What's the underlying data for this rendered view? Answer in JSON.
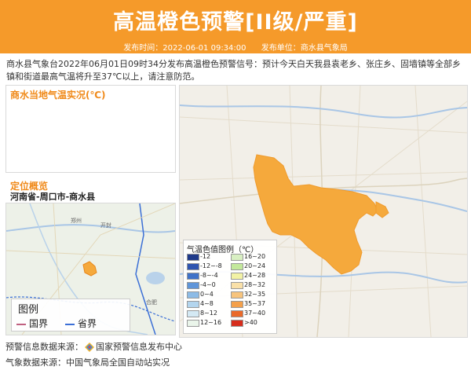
{
  "header": {
    "title": "高温橙色预警[II级/严重]",
    "publish_time_label": "发布时间：2022-06-01 09:34:00",
    "publish_unit_label": "发布单位：商水县气象局"
  },
  "notice_text": "商水县气象台2022年06月01日09时34分发布高温橙色预警信号：预计今天白天我县袁老乡、张庄乡、固墙镇等全部乡镇和街道最高气温将升至37℃以上，请注意防范。",
  "left_panel": {
    "title": "商水当地气温实况(℃)"
  },
  "location": {
    "title": "定位概览",
    "path": "河南省-周口市-商水县"
  },
  "minimap": {
    "legend_title": "图例",
    "items": [
      {
        "label": "国界",
        "color": "#c06080"
      },
      {
        "label": "省界",
        "color": "#3b6fd6"
      }
    ],
    "place_labels": [
      "郑州",
      "开封",
      "合肥"
    ]
  },
  "legend": {
    "title": "气温色值图例（℃）",
    "left": [
      {
        "label": "-12",
        "color": "#1f3a8a"
      },
      {
        "label": "-12~-8",
        "color": "#2f55b0"
      },
      {
        "label": "-8~-4",
        "color": "#3f72c8"
      },
      {
        "label": "-4~0",
        "color": "#5f95d9"
      },
      {
        "label": "0~4",
        "color": "#8dbbe6"
      },
      {
        "label": "4~8",
        "color": "#b3d5ee"
      },
      {
        "label": "8~12",
        "color": "#d4e9f4"
      },
      {
        "label": "12~16",
        "color": "#eaf5ea"
      }
    ],
    "right": [
      {
        "label": "16~20",
        "color": "#d8efc2"
      },
      {
        "label": "20~24",
        "color": "#c3e89b"
      },
      {
        "label": "24~28",
        "color": "#f2f2a5"
      },
      {
        "label": "28~32",
        "color": "#f9e0a8"
      },
      {
        "label": "32~35",
        "color": "#f7c47d"
      },
      {
        "label": "35~37",
        "color": "#f4a04a"
      },
      {
        "label": "37~40",
        "color": "#ea6a2a"
      },
      {
        "label": ">40",
        "color": "#d62d1c"
      }
    ]
  },
  "footer": {
    "warning_source": "预警信息数据来源：",
    "warning_source_name": "国家预警信息发布中心",
    "weather_source": "气象数据来源：中国气象局全国自动站实况"
  },
  "colors": {
    "header_bg": "#f59a2a",
    "accent": "#f08a1a",
    "region_fill": "#f5a93c"
  }
}
